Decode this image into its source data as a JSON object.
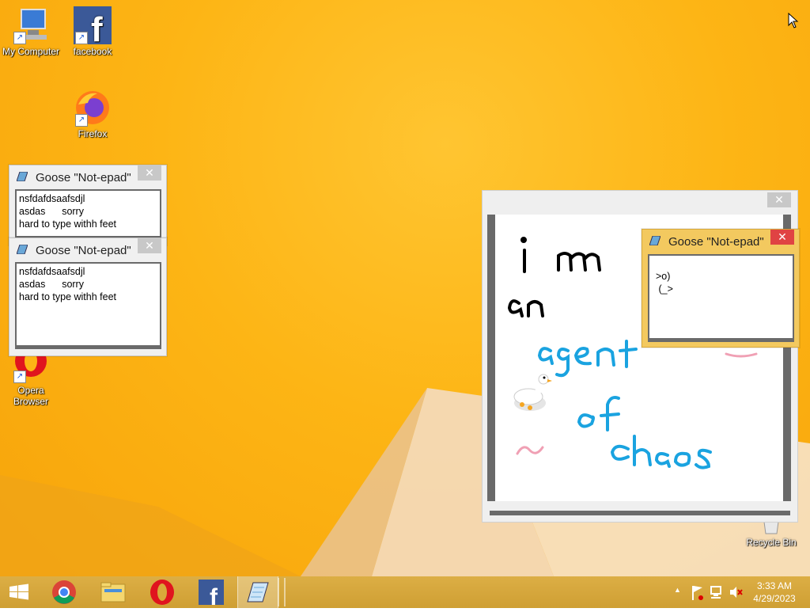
{
  "desktop": {
    "icons": [
      {
        "label": "My Computer",
        "icon": "computer-icon"
      },
      {
        "label": "facebook",
        "icon": "facebook-icon"
      },
      {
        "label": "Firefox",
        "icon": "firefox-icon"
      },
      {
        "label": "Opera\nBrowser",
        "icon": "opera-icon"
      },
      {
        "label": "Recycle Bin",
        "icon": "recycle-bin-icon"
      }
    ]
  },
  "notepad_windows": [
    {
      "title": "Goose \"Not-epad\"",
      "close": "✕",
      "text": "nsfdafdsaafsdjl\nasdas      sorry\nhard to type withh feet"
    },
    {
      "title": "Goose \"Not-epad\"",
      "close": "✕",
      "text": "nsfdafdsaafsdjl\nasdas      sorry\nhard to type withh feet"
    },
    {
      "title": "Goose \"Not-epad\"",
      "close": "✕",
      "text": ">o)\n (_>"
    }
  ],
  "drawing_window": {
    "close": "✕",
    "handwriting": [
      "i m",
      "an",
      "agent",
      "of",
      "chaos"
    ]
  },
  "taskbar": {
    "apps": [
      "start-icon",
      "chrome-icon",
      "file-explorer-icon",
      "opera-icon",
      "facebook-icon",
      "notepad-icon"
    ],
    "tray_icons": [
      "show-hidden-icons-chevron",
      "flag-icon",
      "network-icon",
      "speaker-muted-icon"
    ],
    "tray_chevron": "▲",
    "time": "3:33 AM",
    "date": "4/29/2023"
  },
  "colors": {
    "desktop_yellow": "#fdb515",
    "active_window": "#f3c95f",
    "close_red": "#e04343",
    "ink_black": "#000000",
    "ink_blue": "#1aa3e0",
    "ink_pink": "#f0a0b4"
  }
}
